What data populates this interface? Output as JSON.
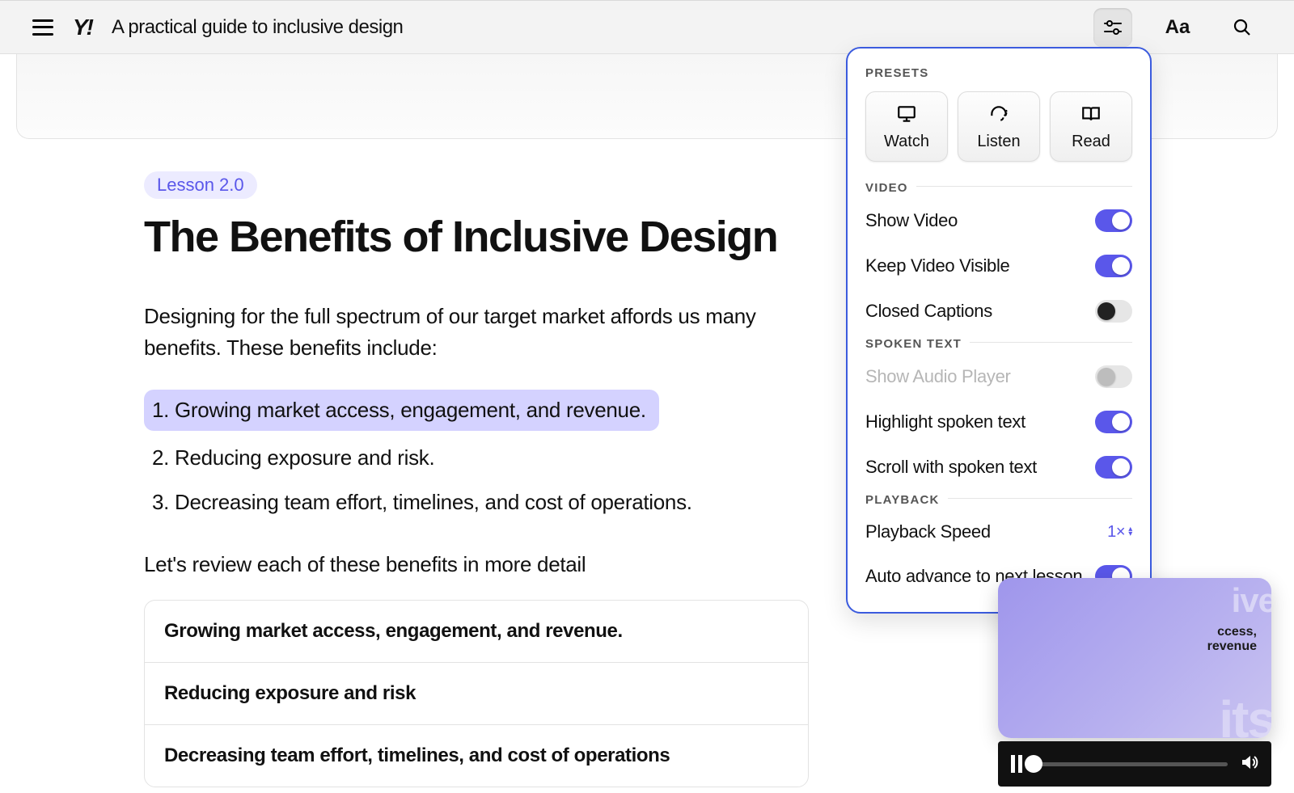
{
  "header": {
    "course_title": "A practical guide to inclusive design"
  },
  "lesson": {
    "badge": "Lesson 2.0",
    "title": "The Benefits of Inclusive Design",
    "intro": "Designing for the full spectrum of our target market affords us many benefits. These benefits include:",
    "bullets": [
      "1. Growing market access, engagement, and revenue.",
      "2. Reducing exposure and risk.",
      "3. Decreasing team effort, timelines, and cost of operations."
    ],
    "review": "Let's review each of these benefits in more detail",
    "accordion": [
      "Growing market access, engagement, and revenue.",
      "Reducing exposure and risk",
      "Decreasing team effort, timelines, and cost of operations"
    ]
  },
  "panel": {
    "presets_label": "PRESETS",
    "presets": {
      "watch": "Watch",
      "listen": "Listen",
      "read": "Read"
    },
    "video_label": "VIDEO",
    "video": {
      "show_video": "Show Video",
      "keep_visible": "Keep Video Visible",
      "closed_captions": "Closed Captions"
    },
    "spoken_label": "SPOKEN TEXT",
    "spoken": {
      "show_audio": "Show Audio Player",
      "highlight": "Highlight spoken text",
      "scroll": "Scroll with spoken text"
    },
    "playback_label": "PLAYBACK",
    "playback": {
      "speed_label": "Playback Speed",
      "speed_value": "1×",
      "auto_advance": "Auto advance to next lesson"
    }
  },
  "float_video": {
    "ghost_title": "ive",
    "caption": "ccess,\nrevenue",
    "ghost_bottom": "its"
  }
}
